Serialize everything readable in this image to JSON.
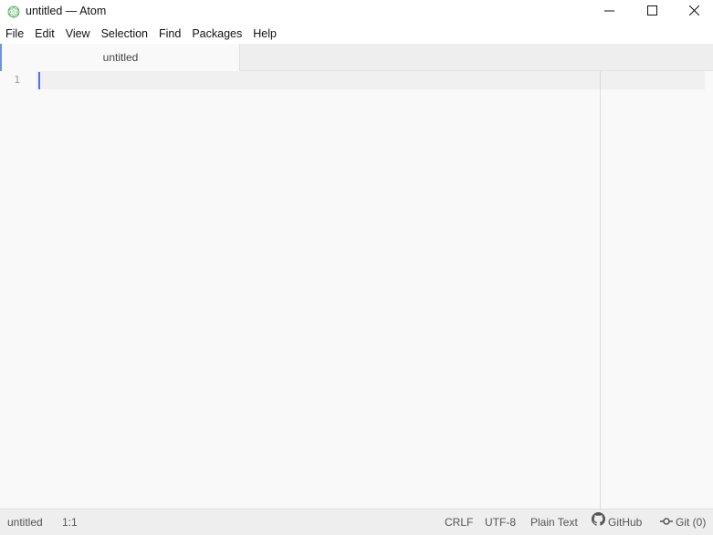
{
  "window": {
    "title": "untitled — Atom",
    "icon": "atom-icon",
    "controls": [
      "minimize-icon",
      "maximize-icon",
      "close-icon"
    ]
  },
  "menu": {
    "items": [
      "File",
      "Edit",
      "View",
      "Selection",
      "Find",
      "Packages",
      "Help"
    ]
  },
  "tabs": [
    {
      "label": "untitled",
      "active": true
    }
  ],
  "editor": {
    "line_numbers": [
      "1"
    ],
    "cursor_color": "#526fff"
  },
  "status": {
    "file": "untitled",
    "position": "1:1",
    "line_ending": "CRLF",
    "encoding": "UTF-8",
    "grammar": "Plain Text",
    "github_label": "GitHub",
    "git_label": "Git (0)",
    "github_icon": "github-icon",
    "git_icon": "git-commit-icon"
  }
}
